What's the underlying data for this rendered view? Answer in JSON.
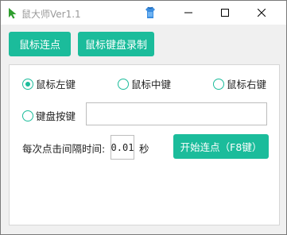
{
  "window": {
    "title": "鼠大师Ver1.1",
    "icons": {
      "app": "cursor-arrow-icon",
      "badge": "shirt-icon"
    },
    "controls": {
      "minimize": "minimize-icon",
      "maximize": "maximize-icon",
      "close": "close-icon"
    }
  },
  "tabs": [
    {
      "label": "鼠标连点"
    },
    {
      "label": "鼠标键盘录制"
    }
  ],
  "panel": {
    "mouse_buttons": [
      {
        "label": "鼠标左键",
        "selected": true
      },
      {
        "label": "鼠标中键",
        "selected": false
      },
      {
        "label": "鼠标右键",
        "selected": false
      }
    ],
    "keyboard_key": {
      "label": "键盘按键",
      "selected": false,
      "value": ""
    },
    "interval": {
      "label": "每次点击间隔时间:",
      "value": "0.01",
      "unit": "秒"
    },
    "start_button": {
      "label": "开始连点（F8键）"
    }
  },
  "colors": {
    "accent": "#1bbc9b",
    "title_text": "#9a9a9a",
    "arrow": "#2e9e2e"
  }
}
